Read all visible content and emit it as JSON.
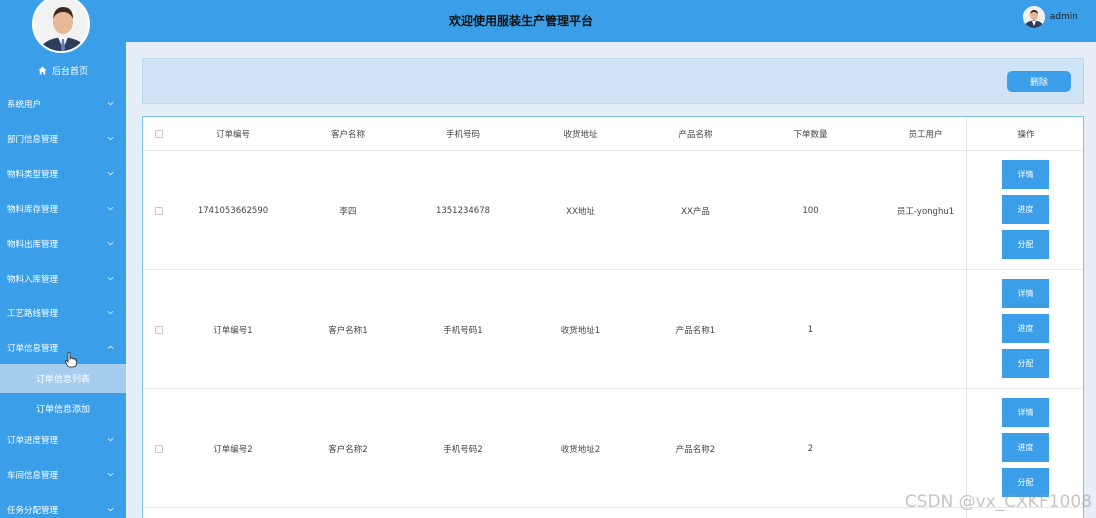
{
  "sidebar": {
    "home_label": "后台首页",
    "menu": [
      {
        "label": "系统用户"
      },
      {
        "label": "部门信息管理"
      },
      {
        "label": "物料类型管理"
      },
      {
        "label": "物料库存管理"
      },
      {
        "label": "物料出库管理"
      },
      {
        "label": "物料入库管理"
      },
      {
        "label": "工艺路线管理"
      },
      {
        "label": "订单信息管理"
      },
      {
        "label": "订单进度管理"
      },
      {
        "label": "车间信息管理"
      },
      {
        "label": "任务分配管理"
      }
    ],
    "submenu": [
      {
        "label": "订单信息列表"
      },
      {
        "label": "订单信息添加"
      }
    ]
  },
  "header": {
    "title": "欢迎使用服装生产管理平台",
    "username": "admin"
  },
  "toolbar": {
    "delete_label": "删除"
  },
  "table": {
    "headers": [
      "订单编号",
      "客户名称",
      "手机号码",
      "收货地址",
      "产品名称",
      "下单数量",
      "员工用户",
      "操作"
    ],
    "rows": [
      {
        "order_no": "1741053662590",
        "customer": "李四",
        "phone": "1351234678",
        "address": "XX地址",
        "product": "XX产品",
        "qty": "100",
        "staff": "员工-yonghu1"
      },
      {
        "order_no": "订单编号1",
        "customer": "客户名称1",
        "phone": "手机号码1",
        "address": "收货地址1",
        "product": "产品名称1",
        "qty": "1",
        "staff": ""
      },
      {
        "order_no": "订单编号2",
        "customer": "客户名称2",
        "phone": "手机号码2",
        "address": "收货地址2",
        "product": "产品名称2",
        "qty": "2",
        "staff": ""
      }
    ],
    "actions": {
      "detail": "详情",
      "progress": "进度",
      "assign": "分配"
    }
  },
  "watermark": "CSDN @vx_CXKF1008",
  "colors": {
    "primary": "#3a9fe8",
    "active_sub": "#a7cdee",
    "toolbar_bg": "#cfe5f7"
  }
}
